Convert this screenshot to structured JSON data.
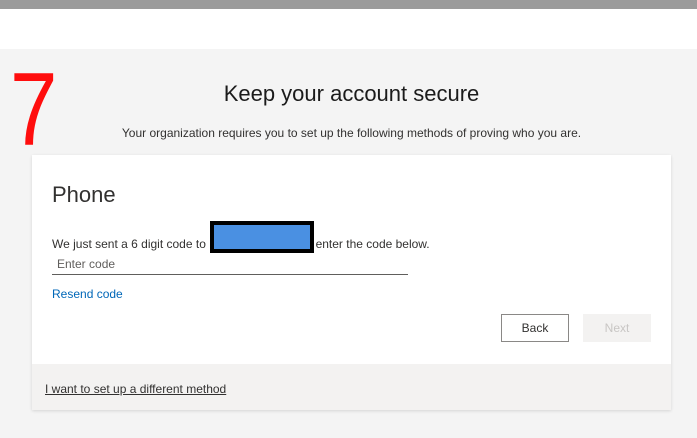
{
  "annotation": {
    "step_number": "7",
    "step_color": "#ff0d0d"
  },
  "header": {
    "title": "Keep your account secure",
    "subtitle": "Your organization requires you to set up the following methods of proving who you are."
  },
  "card": {
    "method_title": "Phone",
    "instruction_before": "We just sent a 6 digit code to",
    "instruction_after": "enter the code below.",
    "code_input": {
      "value": "",
      "placeholder": "Enter code"
    },
    "resend_label": "Resend code",
    "back_label": "Back",
    "next_label": "Next",
    "footer_link": "I want to set up a different method"
  },
  "colors": {
    "accent_link": "#0067b8",
    "redaction_fill": "#4a90e2",
    "redaction_border": "#000000",
    "disabled_text": "#c8c6c4"
  }
}
